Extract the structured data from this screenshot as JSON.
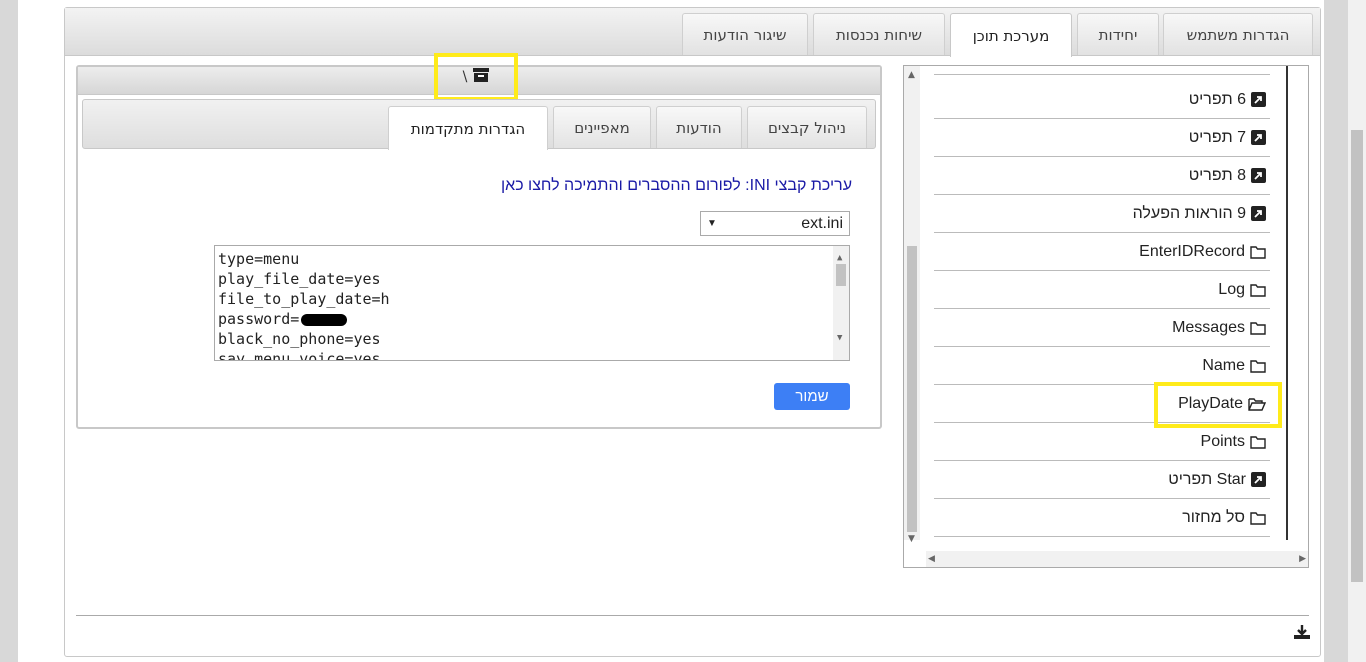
{
  "main_tabs": [
    {
      "label": "הגדרות משתמש"
    },
    {
      "label": "יחידות"
    },
    {
      "label": "מערכת תוכן",
      "active": true
    },
    {
      "label": "שיחות נכנסות"
    },
    {
      "label": "שיגור הודעות"
    }
  ],
  "tree": {
    "items": [
      {
        "label": "6 תפריט",
        "icon": "shortcut-icon"
      },
      {
        "label": "7 תפריט",
        "icon": "shortcut-icon"
      },
      {
        "label": "8 תפריט",
        "icon": "shortcut-icon"
      },
      {
        "label": "9 הוראות הפעלה",
        "icon": "shortcut-icon"
      },
      {
        "label": "EnterIDRecord",
        "icon": "folder-icon"
      },
      {
        "label": "Log",
        "icon": "folder-icon"
      },
      {
        "label": "Messages",
        "icon": "folder-icon"
      },
      {
        "label": "Name",
        "icon": "folder-icon"
      },
      {
        "label": "PlayDate",
        "icon": "folder-open-icon",
        "selected": true
      },
      {
        "label": "Points",
        "icon": "folder-icon"
      },
      {
        "label": "Star תפריט",
        "icon": "shortcut-icon"
      },
      {
        "label": "סל מחזור",
        "icon": "folder-icon"
      }
    ]
  },
  "editor": {
    "path": "\\",
    "path_icon": "archive-icon",
    "subtabs": [
      {
        "label": "ניהול קבצים"
      },
      {
        "label": "הודעות"
      },
      {
        "label": "מאפיינים"
      },
      {
        "label": "הגדרות מתקדמות",
        "active": true
      }
    ],
    "ini_title": "עריכת קבצי INI:",
    "ini_link": "לפורום ההסברים והתמיכה לחצו כאן",
    "file_select": "ext.ini",
    "lines": [
      "type=menu",
      "play_file_date=yes",
      "file_to_play_date=h",
      "password=",
      "black_no_phone=yes",
      "say_menu_voice=yes"
    ],
    "save_label": "שמור"
  },
  "colors": {
    "accent": "#3d7ff5",
    "highlight": "#ffeb1a",
    "link": "#1a1aa6"
  }
}
